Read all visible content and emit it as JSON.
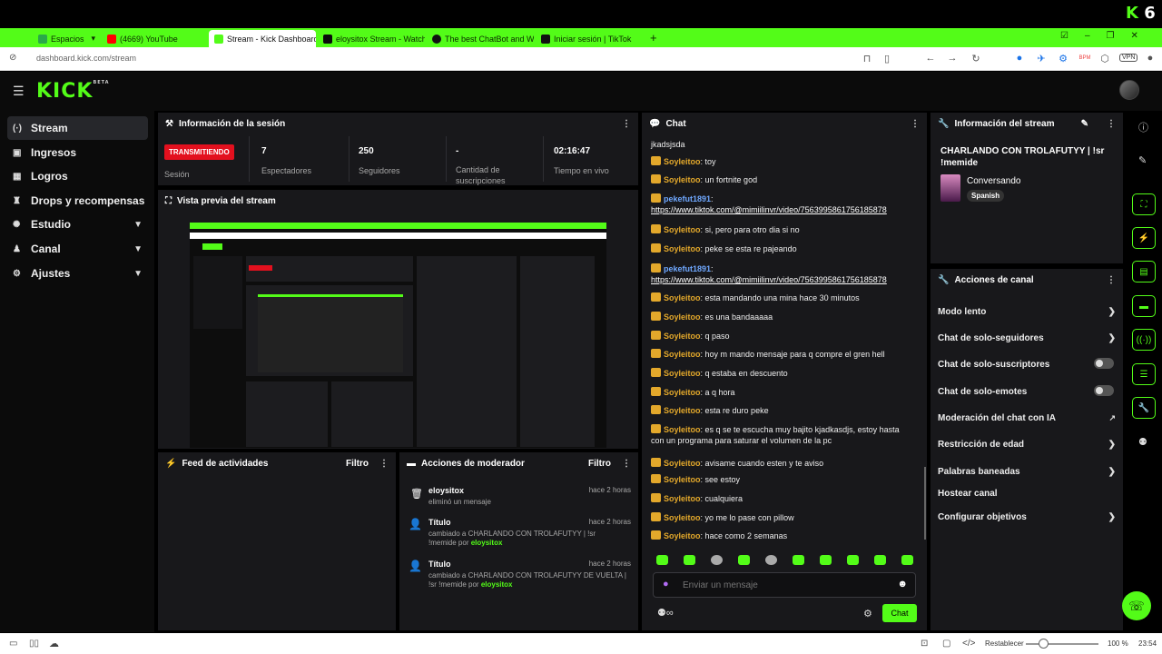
{
  "browser": {
    "tabs": [
      {
        "label": "Espacios",
        "color": "#2aa84a"
      },
      {
        "label": "(4669) YouTube",
        "color": "#ff0000"
      },
      {
        "label": "Stream - Kick Dashboard",
        "color": "#53fc18"
      },
      {
        "label": "eloysitox Stream - Watch L",
        "color": "#53fc18"
      },
      {
        "label": "The best ChatBot and Wid",
        "color": "#111111"
      },
      {
        "label": "Iniciar sesión | TikTok",
        "color": "#111111"
      }
    ],
    "url": "dashboard.kick.com/stream",
    "corner_badge": "6",
    "zoom_label": "Restablecer",
    "zoom": "100 %",
    "clock": "23:54",
    "vpn": "VPN"
  },
  "brand": {
    "logo": "KICK",
    "beta": "BETA",
    "accent": "#53fc18"
  },
  "sidebar": {
    "items": [
      {
        "icon": "stream-icon",
        "label": "Stream"
      },
      {
        "icon": "income-icon",
        "label": "Ingresos"
      },
      {
        "icon": "achievements-icon",
        "label": "Logros"
      },
      {
        "icon": "drops-icon",
        "label": "Drops y recompensas"
      },
      {
        "icon": "studio-icon",
        "label": "Estudio"
      },
      {
        "icon": "channel-icon",
        "label": "Canal"
      },
      {
        "icon": "settings-icon",
        "label": "Ajustes"
      }
    ]
  },
  "session": {
    "title": "Información de la sesión",
    "status_badge": "TRANSMITIENDO",
    "session_label": "Sesión",
    "viewers": "7",
    "viewers_label": "Espectadores",
    "followers": "250",
    "followers_label": "Seguidores",
    "subs": "-",
    "subs_label": "Cantidad de suscripciones",
    "time": "02:16:47",
    "time_label": "Tiempo en vivo"
  },
  "preview": {
    "title": "Vista previa del stream"
  },
  "feed": {
    "title": "Feed de actividades",
    "filter": "Filtro"
  },
  "modactions": {
    "title": "Acciones de moderador",
    "filter": "Filtro",
    "items": [
      {
        "title": "eloysitox",
        "time": "hace 2 horas",
        "detail": "eliminó un mensaje",
        "by_prefix": "",
        "by": ""
      },
      {
        "title": "Título",
        "time": "hace 2 horas",
        "detail": "cambiado a CHARLANDO CON TROLAFUTYY | !sr !memide",
        "by_prefix": "por",
        "by": "eloysitox"
      },
      {
        "title": "Título",
        "time": "hace 2 horas",
        "detail": "cambiado a CHARLANDO CON TROLAFUTYY DE VUELTA | !sr !memide",
        "by_prefix": "por",
        "by": "eloysitox"
      }
    ]
  },
  "chat": {
    "title": "Chat",
    "top_fragment": "jkadsjsda",
    "messages": [
      {
        "user": "Soyleitoo",
        "text": "toy"
      },
      {
        "user": "Soyleitoo",
        "text": "un fortnite god"
      },
      {
        "user": "pekefut1891",
        "text": "https://www.tiktok.com/@mimiilinvr/video/7563995861756185878"
      },
      {
        "user": "Soyleitoo",
        "text": "si, pero para otro dia si no"
      },
      {
        "user": "Soyleitoo",
        "text": "peke se esta re pajeando"
      },
      {
        "user": "pekefut1891",
        "text": "https://www.tiktok.com/@mimiilinvr/video/7563995861756185878"
      },
      {
        "user": "Soyleitoo",
        "text": "esta mandando una mina hace 30 minutos"
      },
      {
        "user": "Soyleitoo",
        "text": "es una bandaaaaa"
      },
      {
        "user": "Soyleitoo",
        "text": "q paso"
      },
      {
        "user": "Soyleitoo",
        "text": "hoy m mando mensaje para q compre el gren hell"
      },
      {
        "user": "Soyleitoo",
        "text": "q estaba en descuento"
      },
      {
        "user": "Soyleitoo",
        "text": "a q hora"
      },
      {
        "user": "Soyleitoo",
        "text": "esta re duro peke"
      },
      {
        "user": "Soyleitoo",
        "text": "es q se te escucha muy bajito kjadkasdjs, estoy hasta con un programa para saturar el volumen de la pc"
      },
      {
        "user": "Soyleitoo",
        "text": "avisame cuando esten y te aviso"
      },
      {
        "user": "Soyleitoo",
        "text": "see estoy"
      },
      {
        "user": "Soyleitoo",
        "text": "cualquiera"
      },
      {
        "user": "Soyleitoo",
        "text": "yo me lo pase con pillow"
      },
      {
        "user": "Soyleitoo",
        "text": "hace como 2 semanas"
      }
    ],
    "input_placeholder": "Enviar un mensaje",
    "send_label": "Chat"
  },
  "streaminfo": {
    "title": "Información del stream",
    "stream_title": "CHARLANDO CON TROLAFUTYY | !sr !memide",
    "category": "Conversando",
    "language": "Spanish"
  },
  "channelactions": {
    "title": "Acciones de canal",
    "items": [
      {
        "label": "Modo lento",
        "control": "chevron"
      },
      {
        "label": "Chat de solo-seguidores",
        "control": "chevron"
      },
      {
        "label": "Chat de solo-suscriptores",
        "control": "toggle"
      },
      {
        "label": "Chat de solo-emotes",
        "control": "toggle"
      },
      {
        "label": "Moderación del chat con IA",
        "control": "external"
      },
      {
        "label": "Restricción de edad",
        "control": "chevron"
      },
      {
        "label": "Palabras baneadas",
        "control": "chevron"
      },
      {
        "label": "Hostear canal",
        "control": "none"
      },
      {
        "label": "Configurar objetivos",
        "control": "chevron"
      }
    ]
  }
}
